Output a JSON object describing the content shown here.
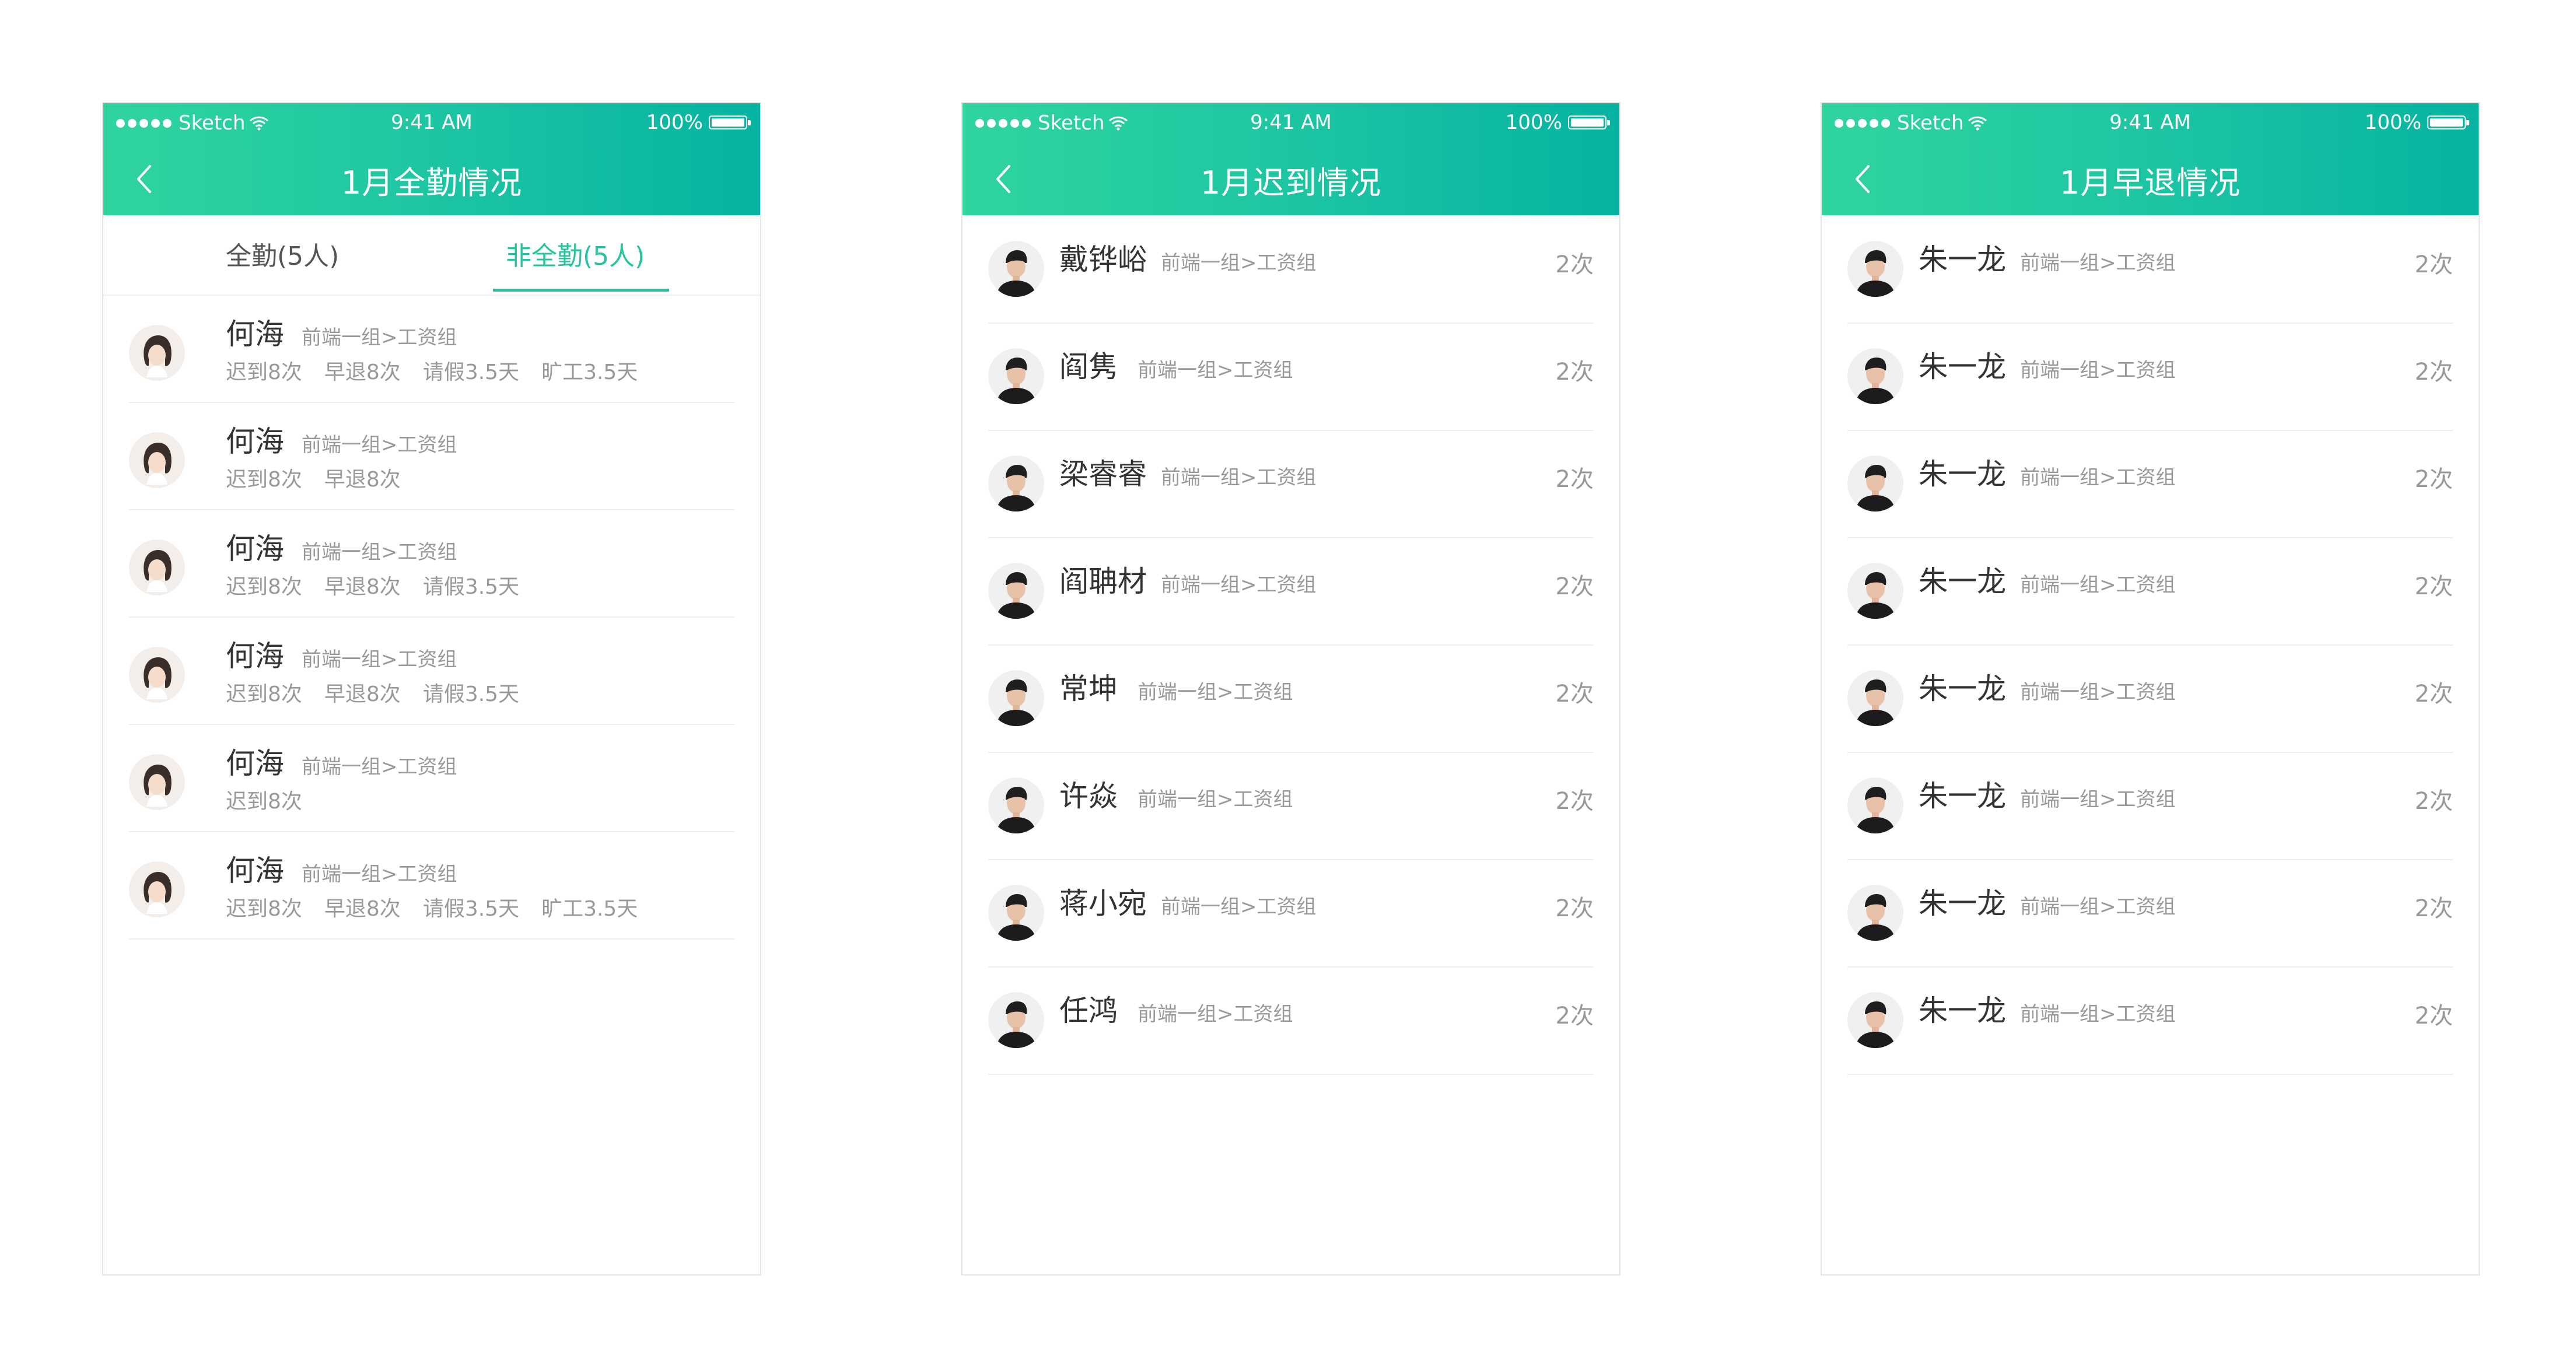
{
  "status": {
    "carrier": "Sketch",
    "time": "9:41 AM",
    "battery": "100%"
  },
  "screens": [
    {
      "title": "1月全勤情况",
      "tabs": [
        {
          "label": "全勤(5人)"
        },
        {
          "label": "非全勤(5人)"
        }
      ],
      "rows": [
        {
          "name": "何海",
          "dept": "前端一组>工资组",
          "stats": [
            "迟到8次",
            "早退8次",
            "请假3.5天",
            "旷工3.5天"
          ]
        },
        {
          "name": "何海",
          "dept": "前端一组>工资组",
          "stats": [
            "迟到8次",
            "早退8次"
          ]
        },
        {
          "name": "何海",
          "dept": "前端一组>工资组",
          "stats": [
            "迟到8次",
            "早退8次",
            "请假3.5天"
          ]
        },
        {
          "name": "何海",
          "dept": "前端一组>工资组",
          "stats": [
            "迟到8次",
            "早退8次",
            "请假3.5天"
          ]
        },
        {
          "name": "何海",
          "dept": "前端一组>工资组",
          "stats": [
            "迟到8次"
          ]
        },
        {
          "name": "何海",
          "dept": "前端一组>工资组",
          "stats": [
            "迟到8次",
            "早退8次",
            "请假3.5天",
            "旷工3.5天"
          ]
        }
      ]
    },
    {
      "title": "1月迟到情况",
      "rows": [
        {
          "name": "戴铧峪",
          "dept": "前端一组>工资组",
          "count": "2次"
        },
        {
          "name": "阎隽",
          "dept": "前端一组>工资组",
          "count": "2次"
        },
        {
          "name": "梁睿睿",
          "dept": "前端一组>工资组",
          "count": "2次"
        },
        {
          "name": "阎聃材",
          "dept": "前端一组>工资组",
          "count": "2次"
        },
        {
          "name": "常坤",
          "dept": "前端一组>工资组",
          "count": "2次"
        },
        {
          "name": "许焱",
          "dept": "前端一组>工资组",
          "count": "2次"
        },
        {
          "name": "蒋小宛",
          "dept": "前端一组>工资组",
          "count": "2次"
        },
        {
          "name": "任鸿",
          "dept": "前端一组>工资组",
          "count": "2次"
        }
      ]
    },
    {
      "title": "1月早退情况",
      "rows": [
        {
          "name": "朱一龙",
          "dept": "前端一组>工资组",
          "count": "2次"
        },
        {
          "name": "朱一龙",
          "dept": "前端一组>工资组",
          "count": "2次"
        },
        {
          "name": "朱一龙",
          "dept": "前端一组>工资组",
          "count": "2次"
        },
        {
          "name": "朱一龙",
          "dept": "前端一组>工资组",
          "count": "2次"
        },
        {
          "name": "朱一龙",
          "dept": "前端一组>工资组",
          "count": "2次"
        },
        {
          "name": "朱一龙",
          "dept": "前端一组>工资组",
          "count": "2次"
        },
        {
          "name": "朱一龙",
          "dept": "前端一组>工资组",
          "count": "2次"
        },
        {
          "name": "朱一龙",
          "dept": "前端一组>工资组",
          "count": "2次"
        }
      ]
    }
  ],
  "colors": {
    "accent": "#24c49e",
    "header_start": "#2fd49f",
    "header_end": "#05b3a1"
  },
  "icons": {
    "back": "chevron-left-icon",
    "wifi": "wifi-icon",
    "battery": "battery-icon",
    "avatar": "avatar-icon"
  }
}
